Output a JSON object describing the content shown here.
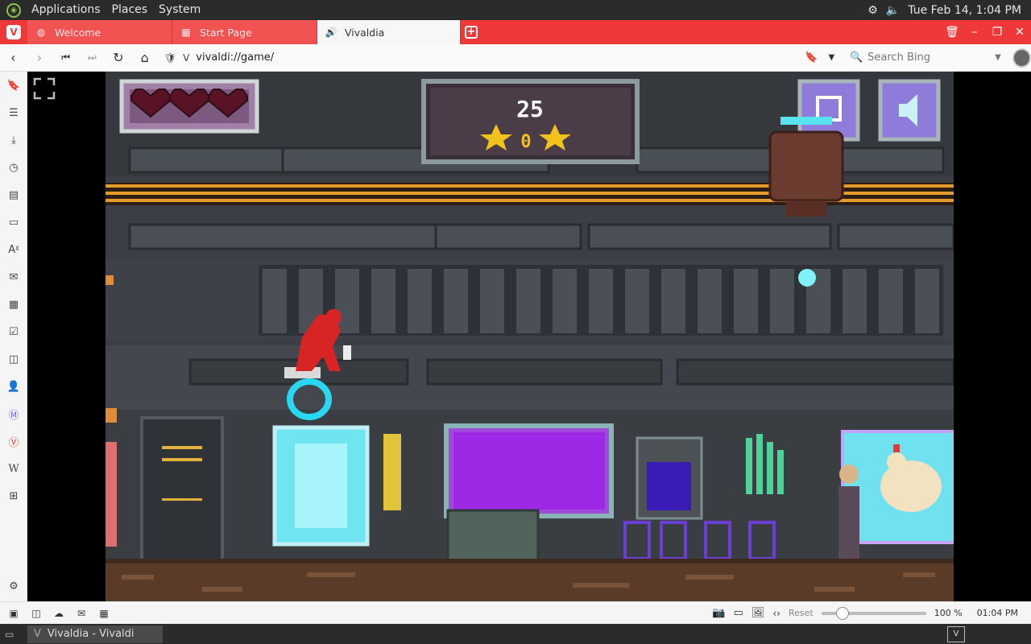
{
  "top_panel": {
    "menus": [
      "Applications",
      "Places",
      "System"
    ],
    "datetime": "Tue Feb 14,  1:04 PM"
  },
  "tabs": [
    {
      "label": "Welcome",
      "icon": "globe-icon",
      "active": false
    },
    {
      "label": "Start Page",
      "icon": "grid-icon",
      "active": false
    },
    {
      "label": "Vivaldia",
      "icon": "speaker-icon",
      "active": true
    }
  ],
  "address": {
    "url": "vivaldi://game/",
    "search_placeholder": "Search Bing"
  },
  "game": {
    "score": "25",
    "stars": "0",
    "hearts": 3
  },
  "statusbar": {
    "reset_label": "Reset",
    "zoom": "100 %",
    "time": "01:04 PM"
  },
  "taskbar": {
    "window_label": "Vivaldia - Vivaldi"
  },
  "colors": {
    "accent": "#ef3939",
    "panel": "#2b2b2b"
  }
}
